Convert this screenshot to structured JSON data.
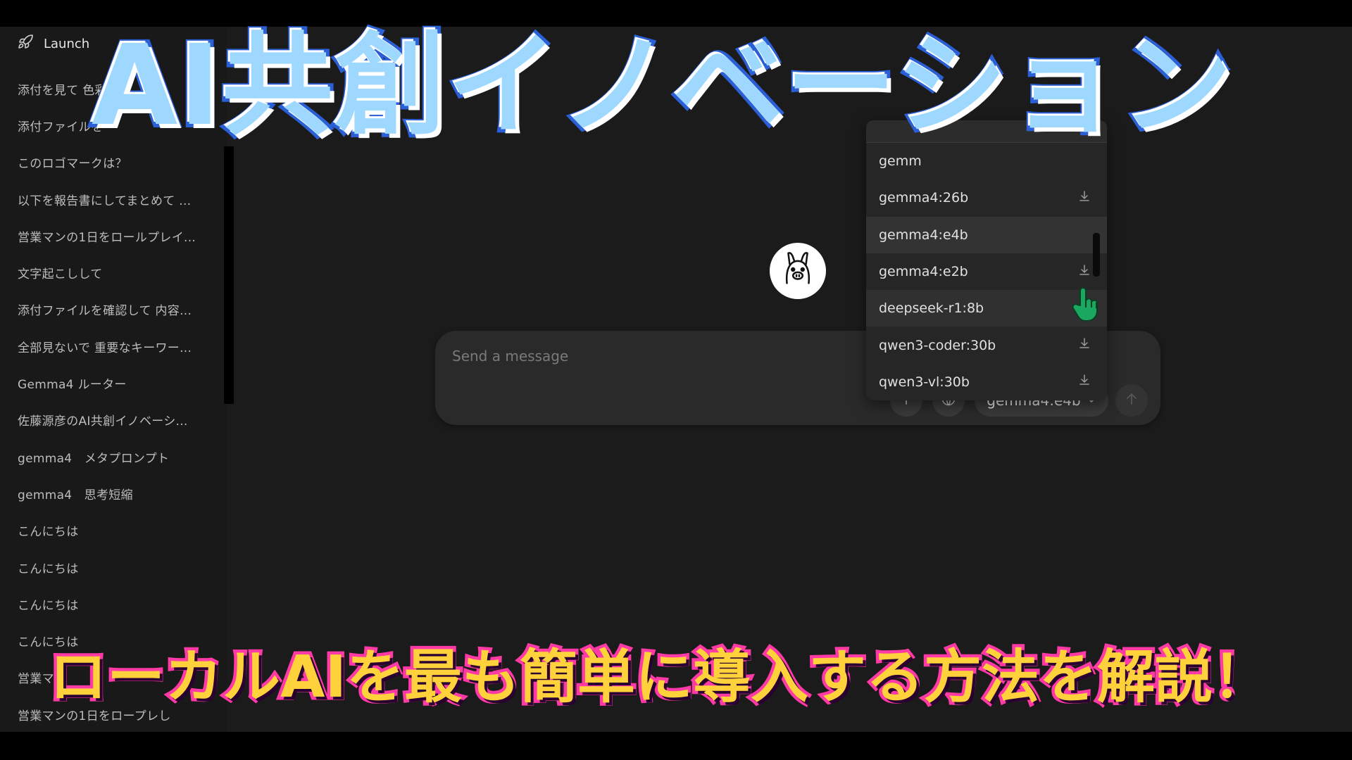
{
  "sidebar": {
    "launch_label": "Launch",
    "history": [
      "添付を見て 色彩",
      "添付ファイルを",
      "このロゴマークは？",
      "以下を報告書にしてまとめて ...",
      "営業マンの1日をロールプレイ...",
      "文字起こしして",
      "添付ファイルを確認して 内容...",
      "全部見ないで 重要なキーワー...",
      "Gemma4 ルーター",
      "佐藤源彦のAI共創イノベーシ...",
      "gemma4　メタプロンプト",
      "gemma4　思考短縮",
      "こんにちは",
      "こんにちは",
      "こんにちは",
      "こんにちは",
      "営業マ",
      "営業マンの1日をロープレし"
    ]
  },
  "composer": {
    "placeholder": "Send a message",
    "model_selected": "gemma4:e4b"
  },
  "dropdown": {
    "models": [
      {
        "name": "gemm",
        "download": false
      },
      {
        "name": "gemma4:26b",
        "download": true
      },
      {
        "name": "gemma4:e4b",
        "download": false
      },
      {
        "name": "gemma4:e2b",
        "download": true
      },
      {
        "name": "deepseek-r1:8b",
        "download": true
      },
      {
        "name": "qwen3-coder:30b",
        "download": true
      },
      {
        "name": "qwen3-vl:30b",
        "download": true
      }
    ]
  },
  "overlay": {
    "title": "AI共創イノベーション",
    "subtitle": "ローカルAIを最も簡単に導入する方法を解説！"
  },
  "colors": {
    "app_bg": "#1b1b1b",
    "sidebar_bg": "#191919",
    "composer_bg": "#2a2a2a",
    "title_fill": "#9ed8ff",
    "title_stroke": "#2b5fd6",
    "subtitle_fill": "#ffd23c",
    "subtitle_stroke": "#ff3aa6",
    "cursor": "#1aa760"
  },
  "icons": {
    "launch": "rocket-icon",
    "add": "plus-icon",
    "web": "globe-icon",
    "send": "arrow-up-icon",
    "model_caret": "chevron-down-icon",
    "download": "download-icon",
    "avatar": "llama-icon",
    "cursor": "hand-pointer-icon"
  }
}
